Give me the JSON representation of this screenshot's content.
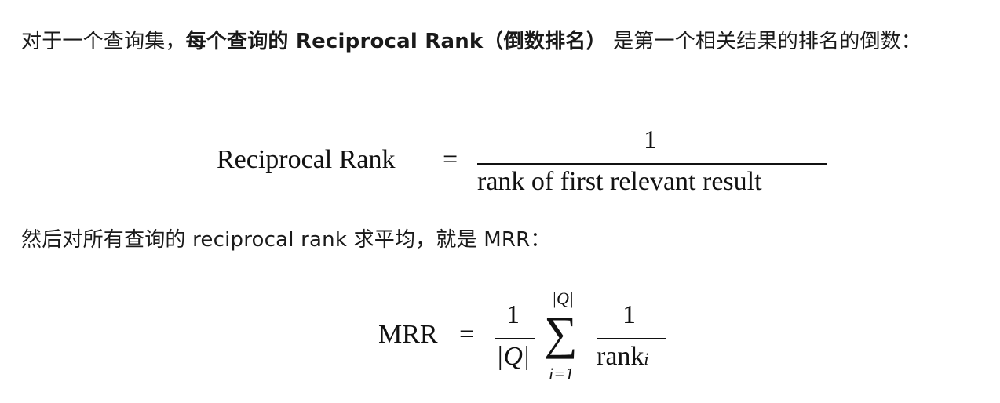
{
  "paragraph1": {
    "prefix": "对于一个查询集，",
    "bold": "每个查询的 Reciprocal Rank（倒数排名）",
    "suffix": " 是第一个相关结果的排名的倒数："
  },
  "equation1": {
    "lhs": "Reciprocal Rank",
    "equals": "=",
    "numerator": "1",
    "denominator": "rank of first relevant result"
  },
  "paragraph2": {
    "text": "然后对所有查询的 reciprocal rank 求平均，就是 MRR："
  },
  "equation2": {
    "lhs": "MRR",
    "equals": "=",
    "frac1_numerator": "1",
    "frac1_denominator": "|Q|",
    "sum_symbol": "∑",
    "sum_upper": "|Q|",
    "sum_lower": "i=1",
    "frac2_numerator": "1",
    "frac2_denominator_text": "rank",
    "frac2_denominator_sub": "i"
  }
}
